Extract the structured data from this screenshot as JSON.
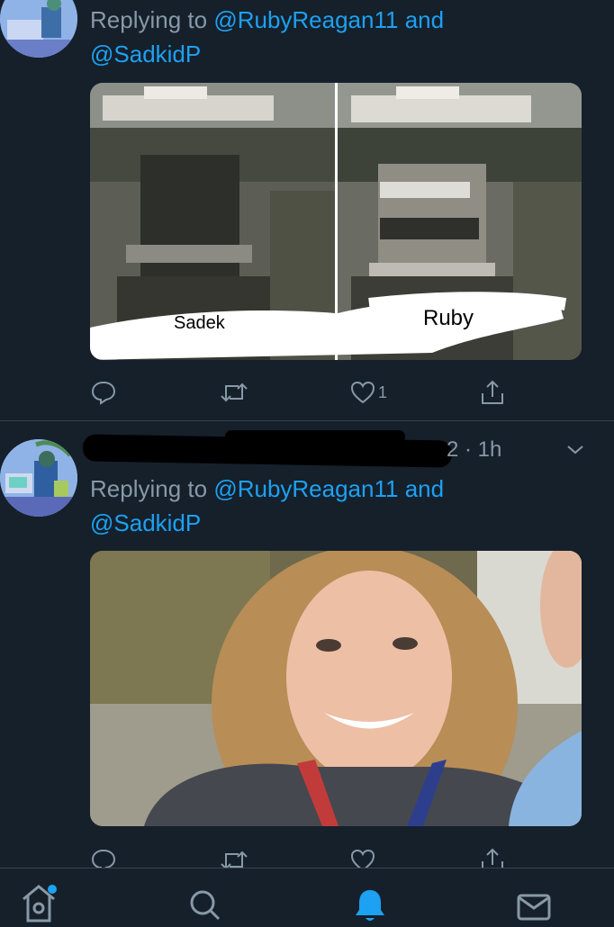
{
  "tweets": [
    {
      "reply_prefix": "Replying to",
      "reply_handle_1": "@RubyReagan11",
      "reply_joiner": "and",
      "reply_handle_2": "@SadkidP",
      "media": {
        "description_icon": "inauguration-crowd-comparison-photo",
        "left_label": "Sadek",
        "right_label": "Ruby"
      },
      "actions": {
        "like_count": "1"
      }
    },
    {
      "timestamp": "2 · 1h",
      "reply_prefix": "Replying to",
      "reply_handle_1": "@RubyReagan11",
      "reply_joiner": "and",
      "reply_handle_2": "@SadkidP",
      "media": {
        "description_icon": "smiling-person-photo"
      }
    }
  ],
  "tabs": [
    "home-icon",
    "search-icon",
    "notifications-icon",
    "messages-icon"
  ],
  "colors": {
    "accent": "#1da1f2",
    "background": "#15202b",
    "muted": "#8899a6",
    "divider": "#38444d"
  }
}
